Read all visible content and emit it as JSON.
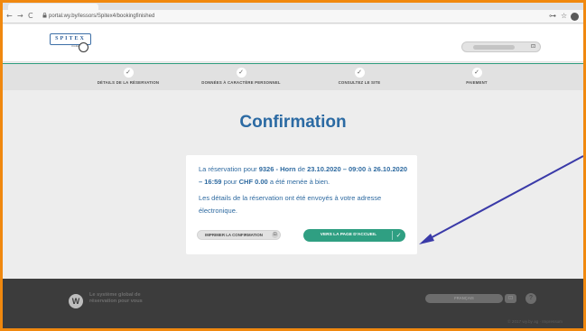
{
  "browser": {
    "url": "portal.wy.by/lessors/Spitex4/bookingfinished",
    "nav": {
      "back": "←",
      "forward": "→",
      "reload": "C"
    },
    "lock_icon": "lock-icon",
    "key_icon": "⊶",
    "star_icon": "☆",
    "profile_icon": "●"
  },
  "header": {
    "logo_text": "SPITEX",
    "logo_sub": "mobil",
    "login_icon": "⊡"
  },
  "steps": [
    {
      "check": "✓",
      "label": "DÉTAILS DE LA RÉSERVATION"
    },
    {
      "check": "✓",
      "label": "DONNÉES À CARACTÈRE PERSONNEL"
    },
    {
      "check": "✓",
      "label": "CONSULTEZ LE SITE"
    },
    {
      "check": "✓",
      "label": "PAIEMENT"
    }
  ],
  "main": {
    "title": "Confirmation",
    "message": {
      "t1": "La réservation pour ",
      "item": "9326 - Horn",
      "t2": " de ",
      "start": "23.10.2020 – 09:00",
      "t3": " à ",
      "end": "26.10.2020 – 16:59",
      "t4": " pour ",
      "price": "CHF 0.00",
      "t5": " a été menée à bien."
    },
    "email_notice": "Les détails de la réservation ont été envoyés à votre adresse électronique.",
    "print_button": "IMPRIMER LA CONFIRMATION",
    "print_icon": "⊡",
    "home_button": "VERS LA PAGE D'ACCUEIL",
    "home_icon": "✓"
  },
  "footer": {
    "logo_letter": "W",
    "slogan": "Le système global de réservation pour vous",
    "language": "FRANÇAIS",
    "lang_toggle": "⊡",
    "help": "?",
    "copyright": "© 2017 wy.by ag · Impressum"
  },
  "colors": {
    "frame": "#f0880f",
    "accent_green": "#2f9f82",
    "title_blue": "#2b6aa3",
    "arrow": "#3a3aa8"
  }
}
